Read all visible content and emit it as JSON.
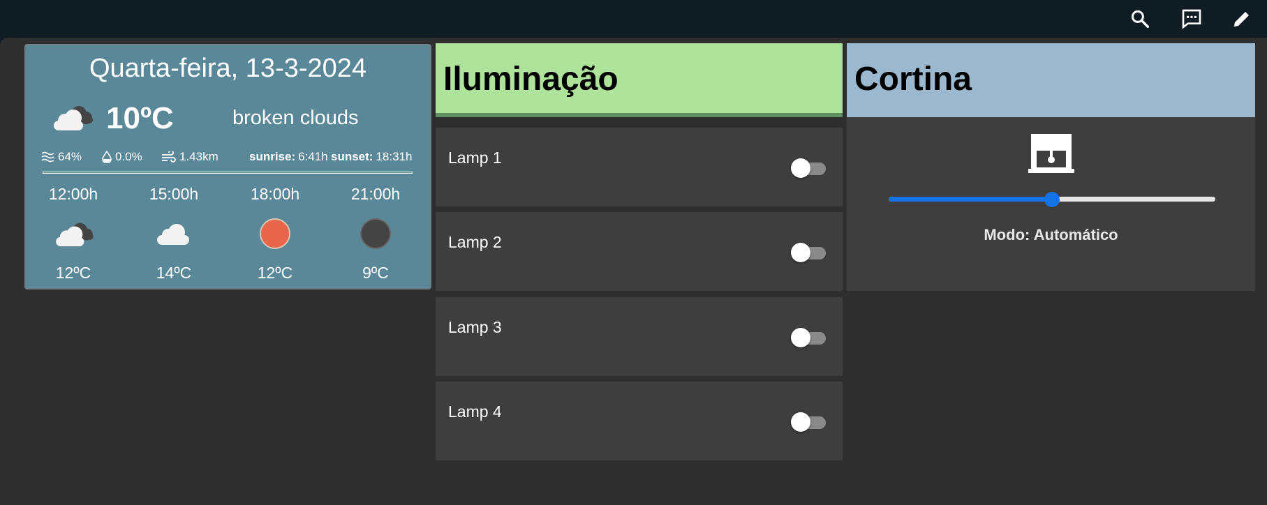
{
  "topbar": {
    "icons": [
      "search-icon",
      "chat-icon",
      "edit-icon"
    ]
  },
  "weather": {
    "date": "Quarta-feira, 13-3-2024",
    "current_icon": "broken-clouds-icon",
    "temperature": "10ºC",
    "description": "broken clouds",
    "humidity": "64%",
    "precipitation": "0.0%",
    "wind": "1.43km",
    "sunrise_label": "sunrise:",
    "sunrise": "6:41h",
    "sunset_label": "sunset:",
    "sunset": "18:31h",
    "forecast": [
      {
        "time": "12:00h",
        "icon": "broken-clouds-icon",
        "temp": "12ºC"
      },
      {
        "time": "15:00h",
        "icon": "cloud-icon",
        "temp": "14ºC"
      },
      {
        "time": "18:00h",
        "icon": "sun-icon",
        "temp": "12ºC"
      },
      {
        "time": "21:00h",
        "icon": "moon-icon",
        "temp": "9ºC"
      }
    ]
  },
  "lighting": {
    "title": "Iluminação",
    "lamps": [
      {
        "label": "Lamp 1",
        "on": false
      },
      {
        "label": "Lamp 2",
        "on": false
      },
      {
        "label": "Lamp 3",
        "on": false
      },
      {
        "label": "Lamp 4",
        "on": false
      }
    ]
  },
  "curtain": {
    "title": "Cortina",
    "icon": "window-blind-icon",
    "position_percent": 50,
    "mode": "Modo: Automático"
  },
  "colors": {
    "weather_bg": "#5a8899",
    "lighting_header": "#afe29b",
    "curtain_header": "#9cb8cf",
    "slider_accent": "#1473e6",
    "sun": "#e8674a"
  }
}
